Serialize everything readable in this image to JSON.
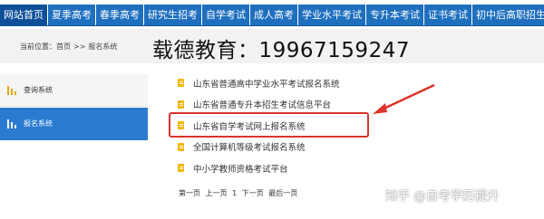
{
  "nav": {
    "items": [
      "网站首页",
      "夏季高考",
      "春季高考",
      "研究生招考",
      "自学考试",
      "成人高考",
      "学业水平考试",
      "专升本考试",
      "证书考试",
      "初中后高职招生"
    ],
    "active": 0
  },
  "breadcrumb": {
    "label": "当前位置：",
    "home": "首页",
    "separator": ">>",
    "current": "报名系统"
  },
  "watermark_title": "载德教育：19967159247",
  "sidebar": {
    "items": [
      {
        "label": "查询系统",
        "active": false
      },
      {
        "label": "报名系统",
        "active": true
      }
    ]
  },
  "list": {
    "items": [
      "山东省普通高中学业水平考试报名系统",
      "山东省普通专升本招生考试信息平台",
      "山东省自学考试网上报名系统",
      "全国计算机等级考试报名系统",
      "中小学教师资格考试平台"
    ],
    "highlighted_index": 2
  },
  "pager": {
    "first": "第一页",
    "prev": "上一页",
    "page": "1",
    "next": "下一页",
    "last": "最后一页"
  },
  "watermark": "知乎 @自考学历提升",
  "colors": {
    "nav_bg": "#1f6fbf",
    "sidebar_active": "#2a7bd0",
    "highlight": "#d9342b",
    "doc_icon": "#f2b705"
  }
}
